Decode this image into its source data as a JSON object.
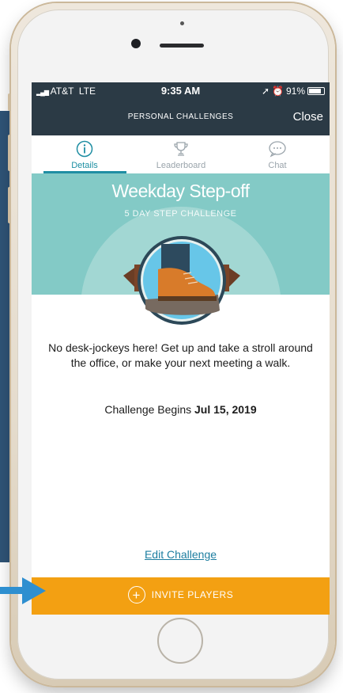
{
  "status": {
    "carrier": "AT&T",
    "network": "LTE",
    "time": "9:35 AM",
    "battery": "91%",
    "battery_level": 0.91
  },
  "nav": {
    "title": "PERSONAL CHALLENGES",
    "close": "Close"
  },
  "tabs": [
    {
      "label": "Details",
      "icon": "info-icon"
    },
    {
      "label": "Leaderboard",
      "icon": "trophy-icon"
    },
    {
      "label": "Chat",
      "icon": "chat-bubble-icon"
    }
  ],
  "challenge": {
    "title": "Weekday Step-off",
    "subtitle": "5 DAY STEP CHALLENGE",
    "description": "No desk-jockeys here! Get up and take a stroll around the office, or make your next meeting a walk.",
    "begins_label": "Challenge Begins",
    "begins_date": "Jul 15, 2019"
  },
  "actions": {
    "edit": "Edit Challenge",
    "invite": "INVITE PLAYERS"
  },
  "colors": {
    "header": "#2b3a45",
    "teal": "#83cac6",
    "accent": "#1f8ea3",
    "invite": "#f3a012",
    "arrow": "#2e8fd0"
  }
}
